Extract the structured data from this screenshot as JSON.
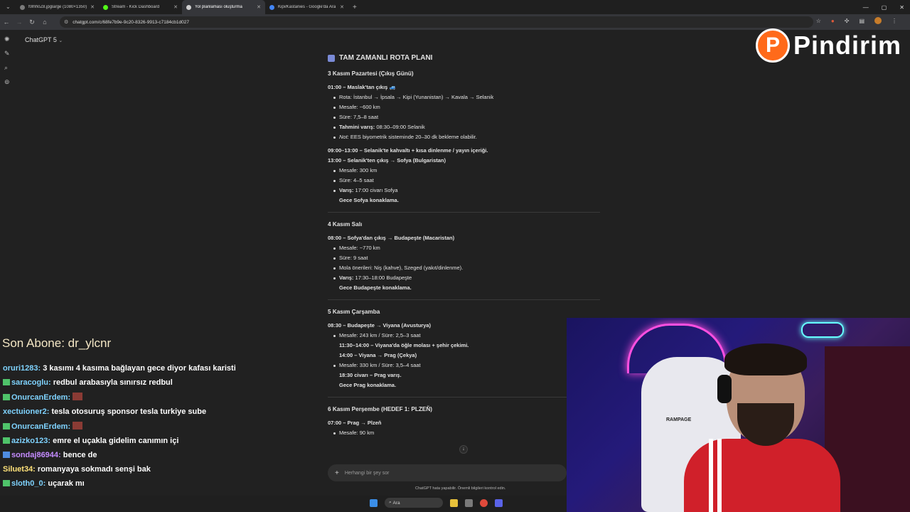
{
  "browser": {
    "tabs": [
      {
        "label": "f0lhh0Z8.jpglarge (1080×1350)",
        "color": "#7b7b7b"
      },
      {
        "label": "Stream - Kick Dashboard",
        "color": "#53fc18"
      },
      {
        "label": "Yol planlaması oluşturma",
        "color": "#cfcfcf"
      },
      {
        "label": "Kipi/Kastanies - Google'da Ara",
        "color": "#4285f4"
      }
    ],
    "new_tab": "+",
    "url": "chatgpt.com/c/68fe7b9e-9c20-8326-9913-c7184cb1d027"
  },
  "app": {
    "title": "ChatGPT 5"
  },
  "plan": {
    "heading": "TAM ZAMANLI ROTA PLANI",
    "day1": {
      "title": "3 Kasım Pazartesi (Çıkış Günü)",
      "seg1": "01:00 – Maslak'tan çıkış",
      "seg1_emoji": "🚙",
      "items1": [
        "Rota: İstanbul → İpsala → Kipi (Yunanistan) → Kavala → Selanik",
        "Mesafe: ~600 km",
        "Süre: 7,5–8 saat"
      ],
      "arrival_label": "Tahmini varış:",
      "arrival_value": " 08:30–09:00 Selanik",
      "note_label": "Not:",
      "note_value": " EES biyometrik sisteminde 20–30 dk bekleme olabilir.",
      "seg2": "09:00–13:00 – Selanik'te kahvaltı + kısa dinlenme / yayın içeriği.",
      "seg3": "13:00 – Selanik'ten çıkış → Sofya (Bulgaristan)",
      "items3": [
        "Mesafe: 300 km",
        "Süre: 4–5 saat"
      ],
      "arrival3_label": "Varış:",
      "arrival3_value": " 17:00 civarı Sofya",
      "stay": "Gece Sofya konaklama."
    },
    "day2": {
      "title": "4 Kasım Salı",
      "seg1": "08:00 – Sofya'dan çıkış → Budapeşte (Macaristan)",
      "items": [
        "Mesafe: ~770 km",
        "Süre: 9 saat",
        "Mola önerileri: Niş (kahve), Szeged (yakıt/dinlenme)."
      ],
      "arrival_label": "Varış:",
      "arrival_value": " 17:30–18:00 Budapeşte",
      "stay": "Gece Budapeşte konaklama."
    },
    "day3": {
      "title": "5 Kasım Çarşamba",
      "seg1": "08:30 – Budapeşte → Viyana (Avusturya)",
      "item1": "Mesafe: 243 km / Süre: 2,5–3 saat",
      "sub1": "11:30–14:00 – Viyana'da öğle molası + şehir çekimi.",
      "sub2": "14:00 – Viyana → Prag (Çekya)",
      "item2": "Mesafe: 330 km / Süre: 3,5–4 saat",
      "sub3": "18:30 civarı – Prag varış.",
      "stay": "Gece Prag konaklama."
    },
    "day4": {
      "title": "6 Kasım Perşembe (HEDEF 1: PLZEŇ)",
      "seg1": "07:00 – Prag → Plzeň",
      "items": [
        "Mesafe: 90 km"
      ]
    }
  },
  "composer": {
    "placeholder": "Herhangi bir şey sor",
    "disclaimer": "ChatGPT hata yapabilir. Önemli bilgileri kontrol edin."
  },
  "overlay": {
    "logo_letter": "P",
    "logo_text": "Pindirim",
    "last_sub": "Son Abone: dr_ylcnr",
    "chat": [
      {
        "user": "oruri1283:",
        "text": " 3 kasımı 4 kasıma bağlayan gece diyor kafası karisti"
      },
      {
        "user": "saracoglu:",
        "text": " redbul arabasıyla sınırsız redbul"
      },
      {
        "user": "OnurcanErdem:",
        "text": ""
      },
      {
        "user": "xectuioner2:",
        "text": " tesla otosuruş sponsor tesla turkiye sube"
      },
      {
        "user": "OnurcanErdem:",
        "text": ""
      },
      {
        "user": "azizko123:",
        "text": " emre el uçakla gidelim canımın içi"
      },
      {
        "user": "sondaj86944:",
        "text": " bence de"
      },
      {
        "user": "Siluet34:",
        "text": " romanyaya sokmadı senşi bak"
      },
      {
        "user": "sloth0_0:",
        "text": " uçarak mı"
      }
    ]
  },
  "cam": {
    "chair_brand": "RAMPAGE"
  },
  "taskbar": {
    "search": "Ara"
  }
}
